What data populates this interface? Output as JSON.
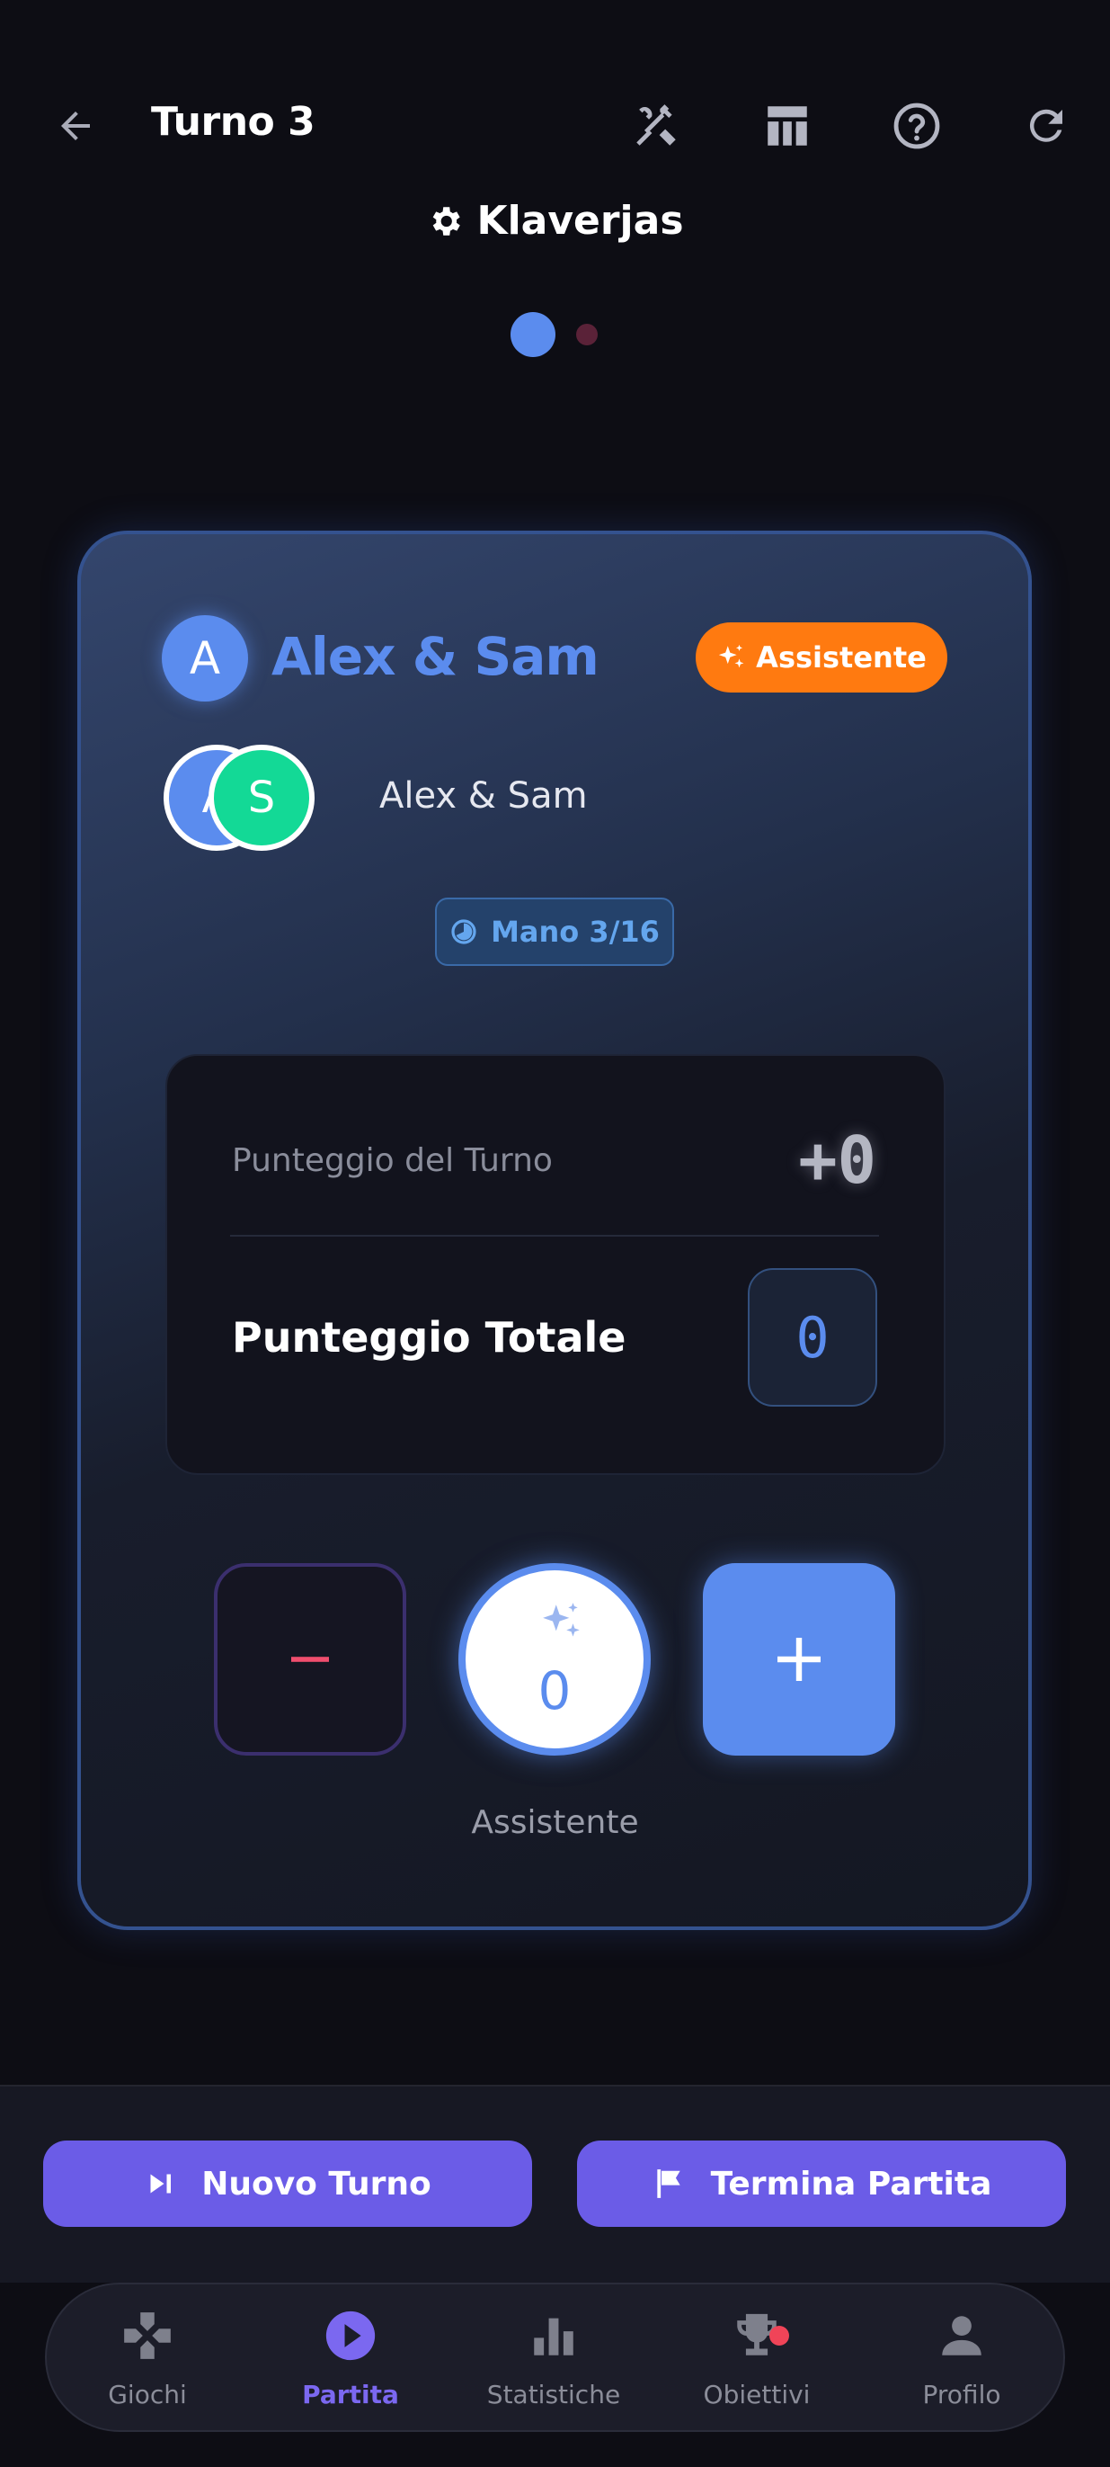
{
  "header": {
    "title": "Turno 3",
    "game_name": "Klaverjas"
  },
  "card": {
    "team_avatar_letter": "A",
    "team_name": "Alex & Sam",
    "assistant_badge": "Assistente",
    "player_avatars": [
      "A",
      "S"
    ],
    "players_label": "Alex & Sam",
    "hand_label": "Mano 3/16",
    "round_score_label": "Punteggio del Turno",
    "round_score_value": "+0",
    "total_score_label": "Punteggio Totale",
    "total_score_value": "0",
    "assistant_value": "0",
    "assistant_caption": "Assistente"
  },
  "actions": {
    "new_round": "Nuovo Turno",
    "end_game": "Termina Partita"
  },
  "nav": {
    "items": [
      {
        "label": "Giochi",
        "icon": "gamepad-icon"
      },
      {
        "label": "Partita",
        "icon": "play-circle-icon"
      },
      {
        "label": "Statistiche",
        "icon": "bar-chart-icon"
      },
      {
        "label": "Obiettivi",
        "icon": "trophy-icon"
      },
      {
        "label": "Profilo",
        "icon": "person-icon"
      }
    ],
    "active": "Partita"
  },
  "colors": {
    "accent_blue": "#5b8cee",
    "accent_purple": "#6b5ce7",
    "assistant_orange": "#ff7a10",
    "player_green": "#13d996",
    "minus_red": "#f04e6e"
  }
}
